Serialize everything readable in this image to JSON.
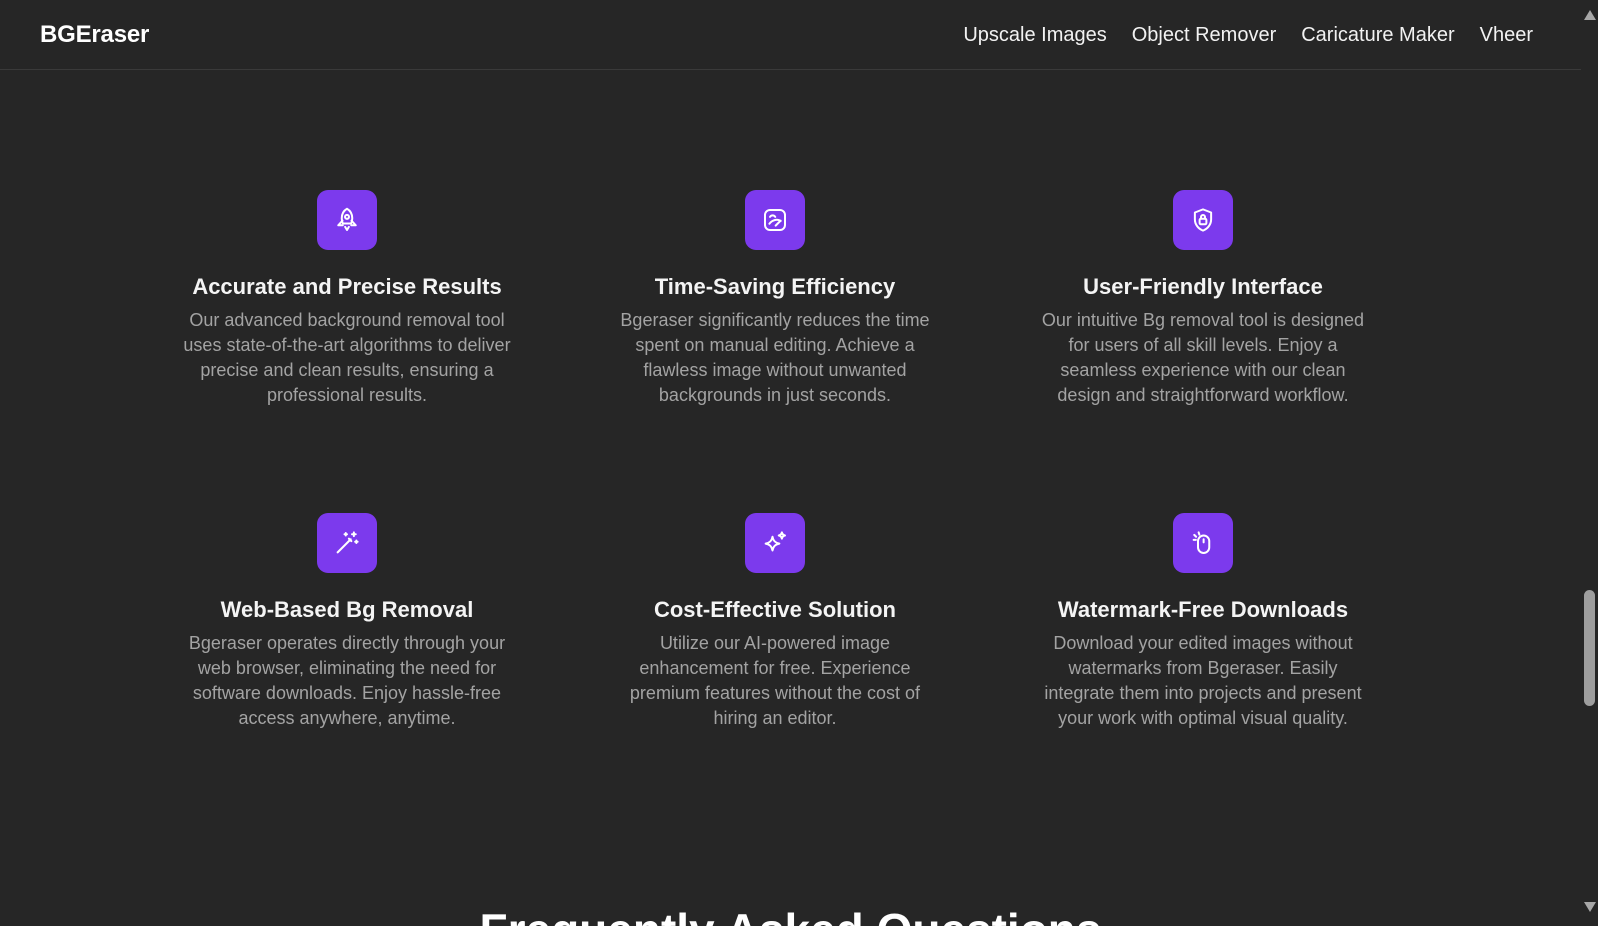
{
  "header": {
    "brand": "BGEraser",
    "nav": [
      {
        "label": "Upscale Images"
      },
      {
        "label": "Object Remover"
      },
      {
        "label": "Caricature Maker"
      },
      {
        "label": "Vheer"
      }
    ]
  },
  "colors": {
    "background": "#262626",
    "accent": "#7c3aed",
    "title": "#f4f4f4",
    "description": "#a3a3a3"
  },
  "features": [
    {
      "icon": "rocket-icon",
      "title": "Accurate and Precise Results",
      "description": "Our advanced background removal tool uses state-of-the-art algorithms to deliver precise and clean results, ensuring a professional results."
    },
    {
      "icon": "image-edit-icon",
      "title": "Time-Saving Efficiency",
      "description": "Bgeraser significantly reduces the time spent on manual editing. Achieve a flawless image without unwanted backgrounds in just seconds."
    },
    {
      "icon": "shield-lock-icon",
      "title": "User-Friendly Interface",
      "description": "Our intuitive Bg removal tool is designed for users of all skill levels. Enjoy a seamless experience with our clean design and straightforward workflow."
    },
    {
      "icon": "magic-wand-icon",
      "title": "Web-Based Bg Removal",
      "description": "Bgeraser operates directly through your web browser, eliminating the need for software downloads. Enjoy hassle-free access anywhere, anytime."
    },
    {
      "icon": "sparkles-icon",
      "title": "Cost-Effective Solution",
      "description": "Utilize our AI-powered image enhancement for free. Experience premium features without the cost of hiring an editor."
    },
    {
      "icon": "mouse-click-icon",
      "title": "Watermark-Free Downloads",
      "description": "Download your edited images without watermarks from Bgeraser. Easily integrate them into projects and present your work with optimal visual quality."
    }
  ],
  "next_section": {
    "heading_partial": "Frequently Asked Questions"
  }
}
